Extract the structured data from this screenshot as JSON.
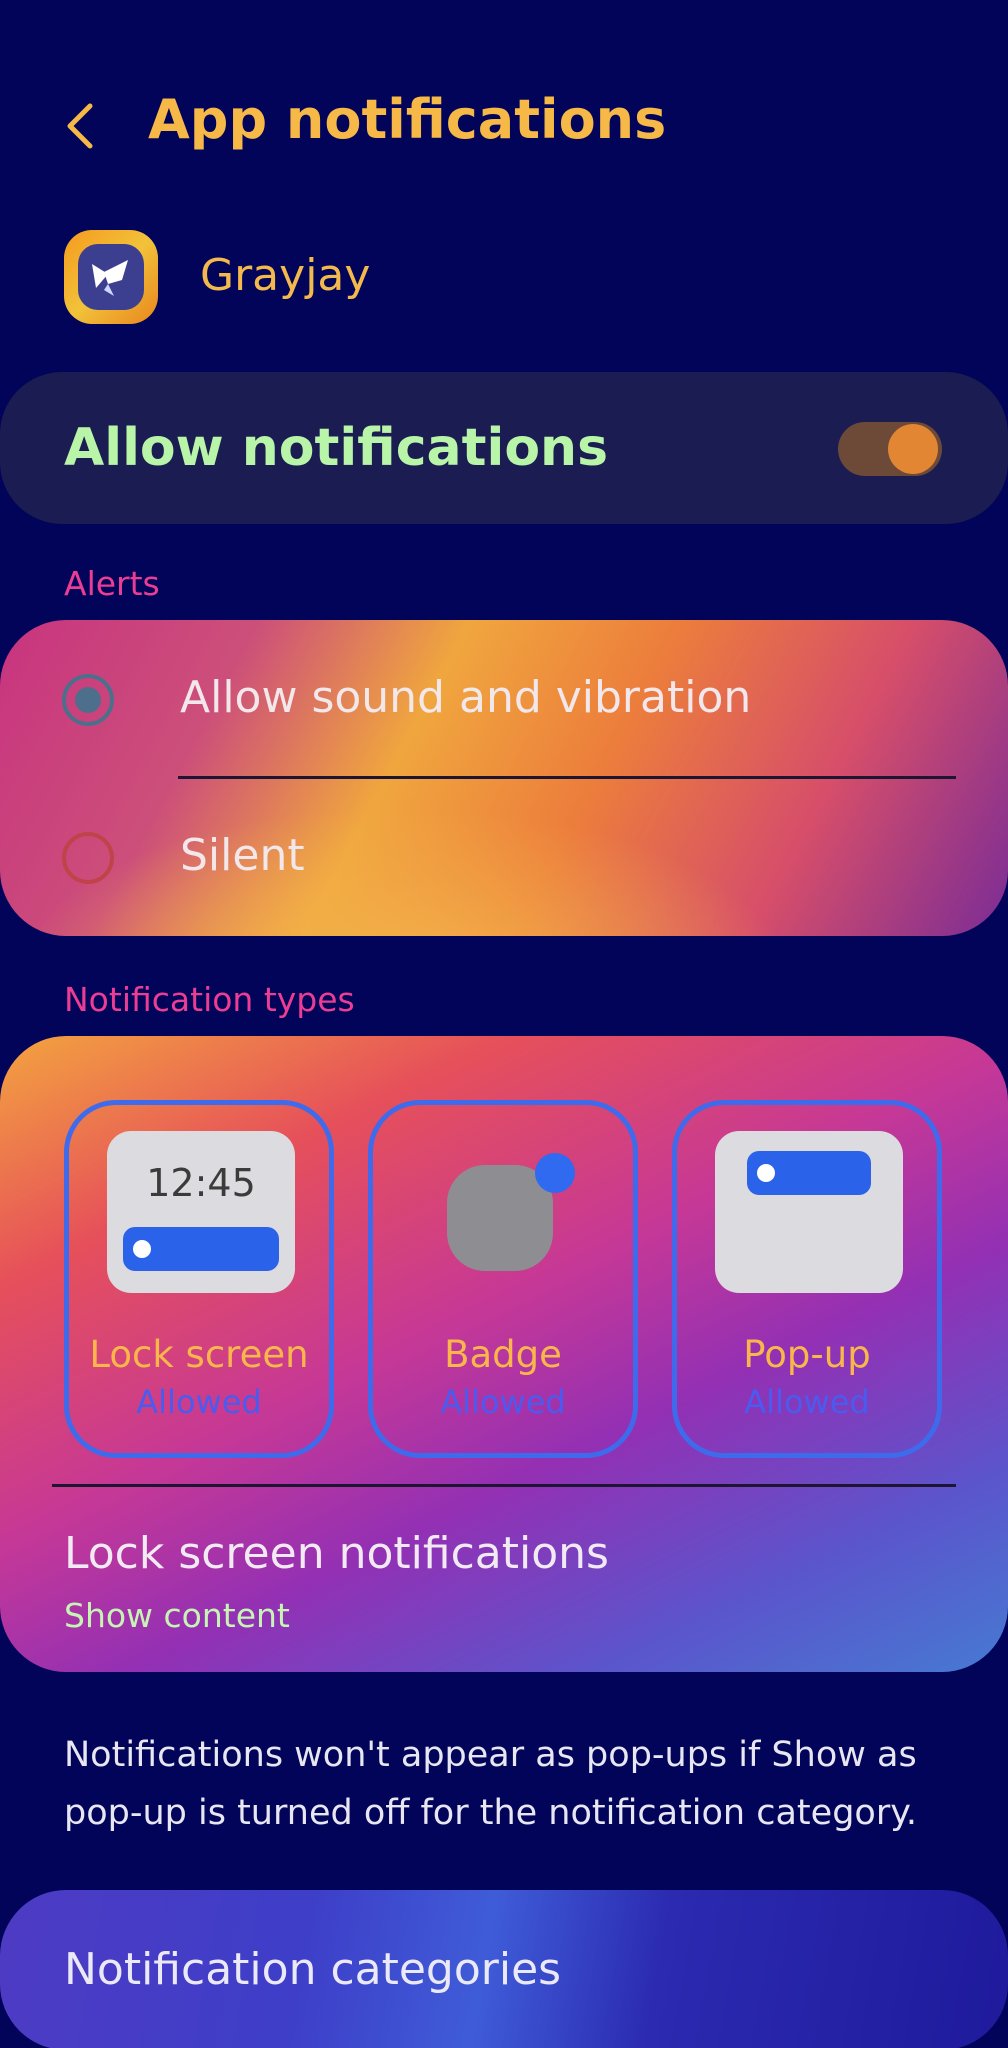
{
  "header": {
    "title": "App notifications",
    "back_icon": "chevron-left-icon"
  },
  "app": {
    "name": "Grayjay",
    "icon": "grayjay-app-icon"
  },
  "allow_notifications": {
    "label": "Allow notifications",
    "enabled": true
  },
  "alerts": {
    "section_label": "Alerts",
    "options": [
      {
        "label": "Allow sound and vibration",
        "selected": true
      },
      {
        "label": "Silent",
        "selected": false
      }
    ]
  },
  "notification_types": {
    "section_label": "Notification types",
    "tiles": [
      {
        "label": "Lock screen",
        "status": "Allowed",
        "preview_time": "12:45"
      },
      {
        "label": "Badge",
        "status": "Allowed"
      },
      {
        "label": "Pop-up",
        "status": "Allowed"
      }
    ],
    "lock_screen_notifications": {
      "title": "Lock screen notifications",
      "value": "Show content"
    }
  },
  "note": "Notifications won't appear as pop-ups if Show as pop-up is turned off for the notification category.",
  "categories": {
    "label": "Notification categories"
  },
  "colors": {
    "background": "#02045a",
    "title": "#f6b847",
    "allow_label": "#b8f5a8",
    "section_label": "#ea3d93",
    "tile_border": "#3e6bec"
  }
}
